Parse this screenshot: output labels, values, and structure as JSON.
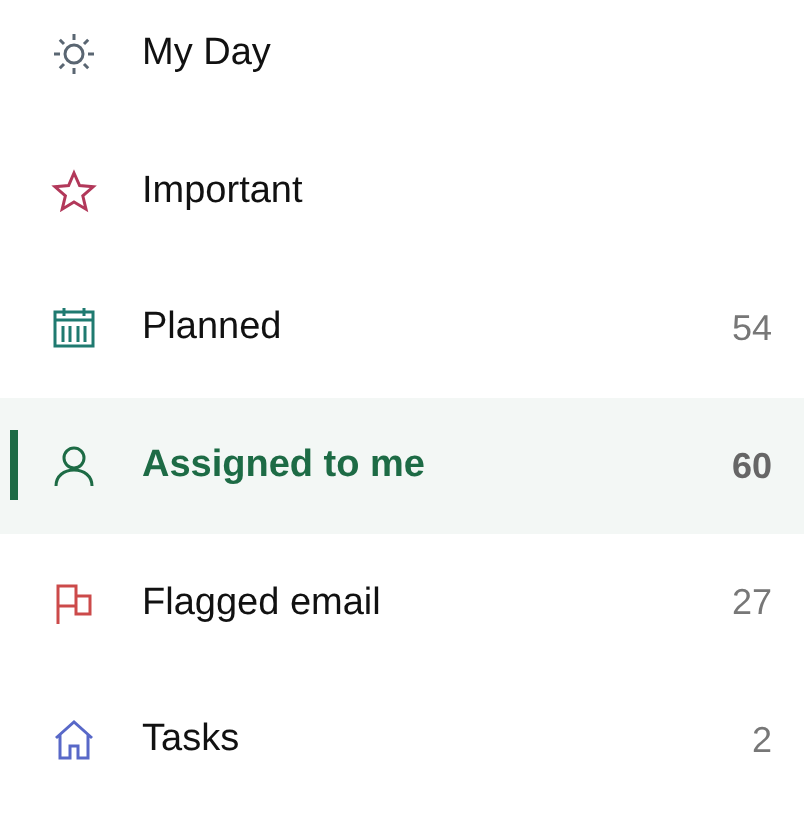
{
  "lists": [
    {
      "label": "My Day",
      "kind": "sun",
      "color": "#5a6672",
      "selected": false
    },
    {
      "label": "Important",
      "kind": "star",
      "color": "#b2385a",
      "selected": false
    },
    {
      "label": "Planned",
      "kind": "calendar",
      "color": "#1f7a70",
      "count": "54",
      "selected": false
    },
    {
      "label": "Assigned to me",
      "kind": "person",
      "color": "#1d6b45",
      "count": "60",
      "selected": true
    },
    {
      "label": "Flagged email",
      "kind": "flag",
      "color": "#cc4a4a",
      "count": "27",
      "selected": false
    },
    {
      "label": "Tasks",
      "kind": "house",
      "color": "#5868c8",
      "count": "2",
      "selected": false
    }
  ]
}
